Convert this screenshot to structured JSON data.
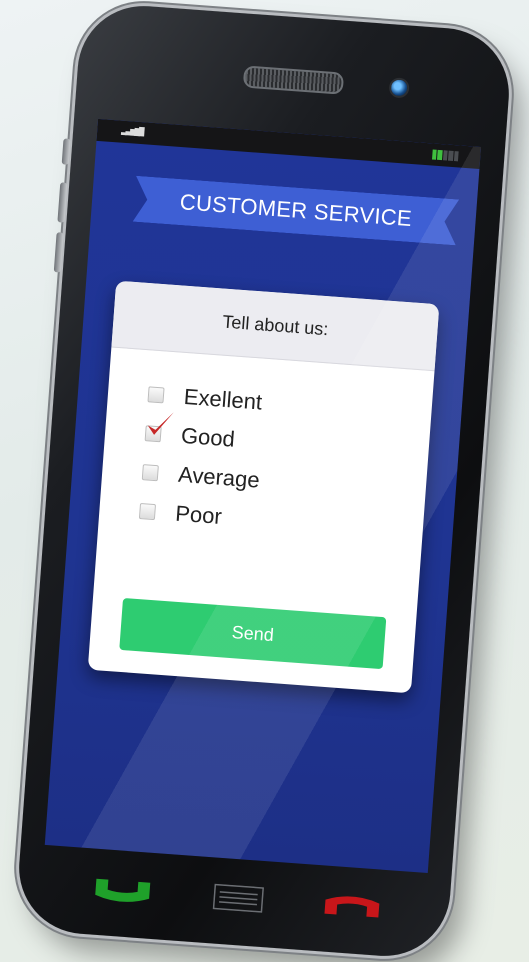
{
  "screen": {
    "title": "CUSTOMER SERVICE",
    "question": "Tell about us:",
    "options": [
      {
        "label": "Exellent",
        "checked": false
      },
      {
        "label": "Good",
        "checked": true
      },
      {
        "label": "Average",
        "checked": false
      },
      {
        "label": "Poor",
        "checked": false
      }
    ],
    "send_label": "Send"
  },
  "status": {
    "signal_icon": "signal-icon",
    "battery_icon": "battery-icon",
    "battery_level": 0.4
  },
  "hardware": {
    "call_icon": "call-icon",
    "menu_icon": "menu-icon",
    "end_call_icon": "end-call-icon"
  },
  "colors": {
    "screen_bg": "#203598",
    "ribbon": "#3e5fd4",
    "send_button": "#2ecc71",
    "call_green": "#1fa12a",
    "end_red": "#c8161a",
    "check_red": "#c62828"
  }
}
